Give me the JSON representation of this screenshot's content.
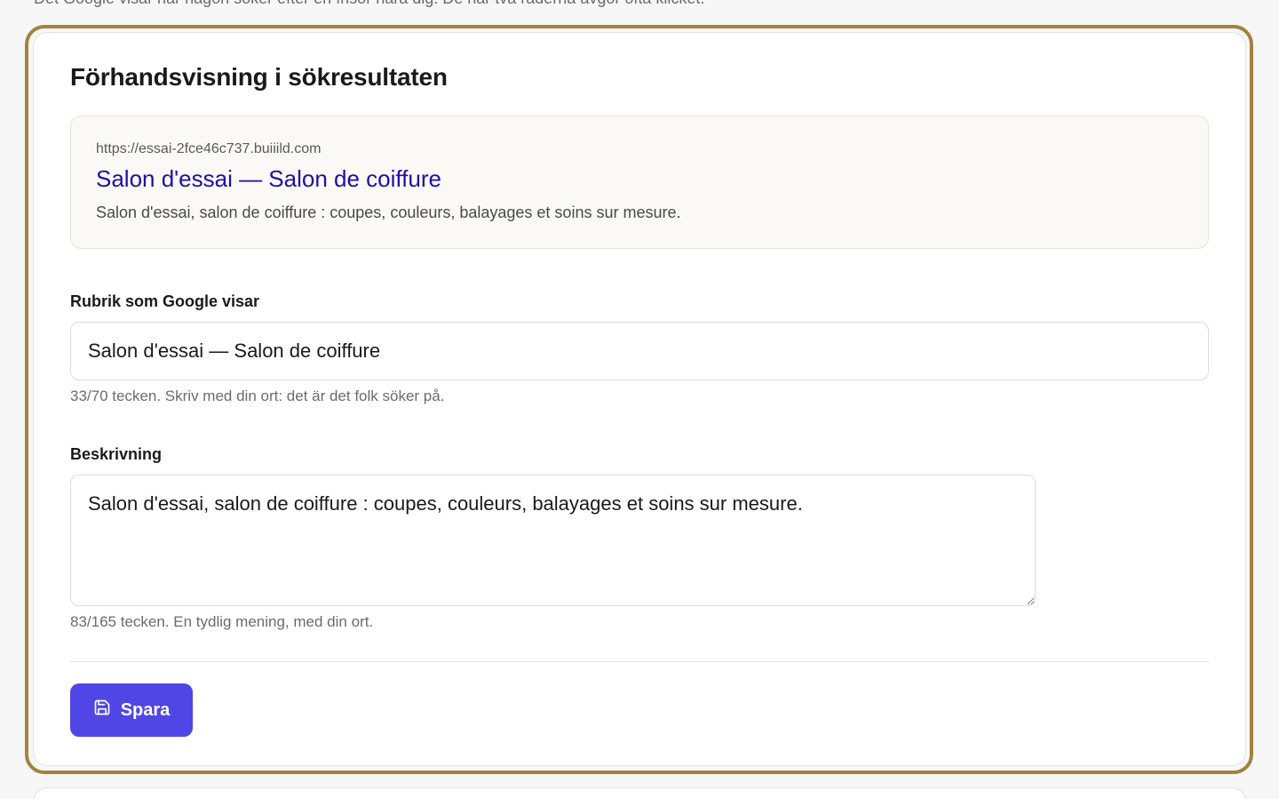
{
  "page": {
    "intro_cut": "Det Google visar när någon söker efter en frisör nära dig. De här två raderna avgör ofta klicket."
  },
  "card": {
    "title": "Förhandsvisning i sökresultaten",
    "accent_color": "#a4813c"
  },
  "preview": {
    "url": "https://essai-2fce46c737.buiiild.com",
    "title": "Salon d'essai — Salon de coiffure",
    "description": "Salon d'essai, salon de coiffure : coupes, couleurs, balayages et soins sur mesure.",
    "title_color": "#1f0fa8"
  },
  "form": {
    "title_field": {
      "label": "Rubrik som Google visar",
      "value": "Salon d'essai — Salon de coiffure",
      "hint": "33/70 tecken. Skriv med din ort: det är det folk söker på."
    },
    "description_field": {
      "label": "Beskrivning",
      "value": "Salon d'essai, salon de coiffure : coupes, couleurs, balayages et soins sur mesure.",
      "hint": "83/165 tecken. En tydlig mening, med din ort."
    }
  },
  "actions": {
    "save_label": "Spara",
    "save_icon": "floppy-disk-icon",
    "button_color": "#4f46e5"
  }
}
